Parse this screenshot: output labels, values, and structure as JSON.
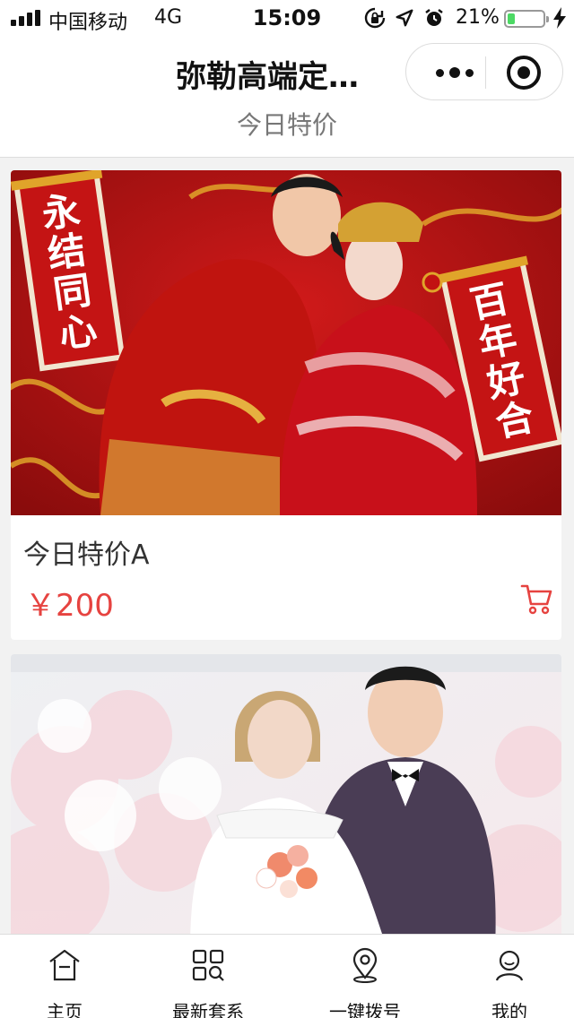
{
  "status_bar": {
    "carrier": "中国移动",
    "network": "4G",
    "time": "15:09",
    "battery_percent_text": "21%",
    "battery_level": 0.21,
    "icons": [
      "signal-icon",
      "rotation-lock-icon",
      "location-icon",
      "alarm-icon",
      "battery-icon",
      "charging-bolt-icon"
    ]
  },
  "nav": {
    "title": "弥勒高端定…",
    "menu_icon": "more-dots-icon",
    "close_icon": "close-circle-icon"
  },
  "page": {
    "header": "今日特价"
  },
  "products": [
    {
      "name": "今日特价A",
      "price": "￥200",
      "image": "chinese-wedding-photo",
      "cart_icon": "cart-icon"
    },
    {
      "image": "western-wedding-photo"
    }
  ],
  "tab_bar": {
    "items": [
      {
        "label": "主页",
        "icon": "home-icon"
      },
      {
        "label": "最新套系",
        "icon": "grid-search-icon"
      },
      {
        "label": "一键拨号",
        "icon": "location-pin-icon"
      },
      {
        "label": "我的",
        "icon": "user-icon"
      }
    ]
  },
  "colors": {
    "price": "#e64340",
    "cart": "#e64340",
    "battery": "#4cd964"
  }
}
